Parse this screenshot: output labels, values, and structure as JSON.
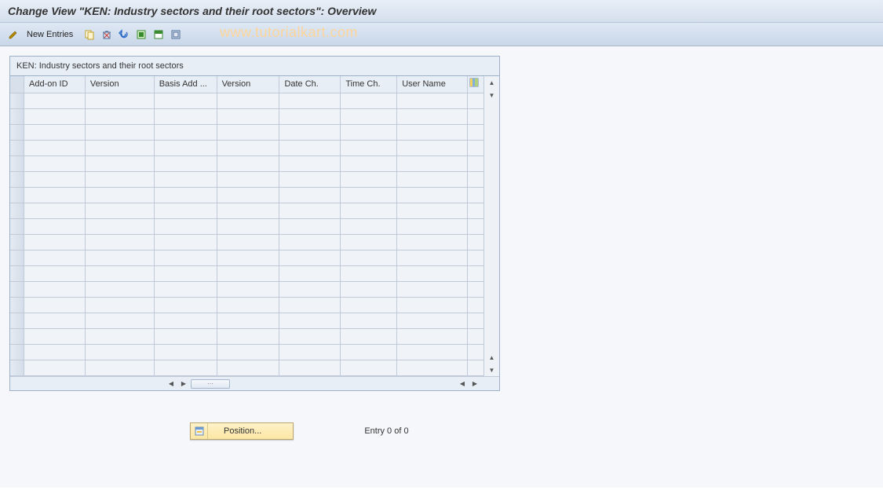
{
  "title": "Change View \"KEN: Industry sectors and their root sectors\": Overview",
  "toolbar": {
    "new_entries_label": "New Entries"
  },
  "watermark": "www.tutorialkart.com",
  "panel": {
    "title": "KEN: Industry sectors and their root sectors"
  },
  "columns": [
    "Add-on ID",
    "Version",
    "Basis Add ...",
    "Version",
    "Date Ch.",
    "Time Ch.",
    "User Name"
  ],
  "row_count": 18,
  "footer": {
    "position_label": "Position...",
    "entry_text": "Entry 0 of 0"
  }
}
